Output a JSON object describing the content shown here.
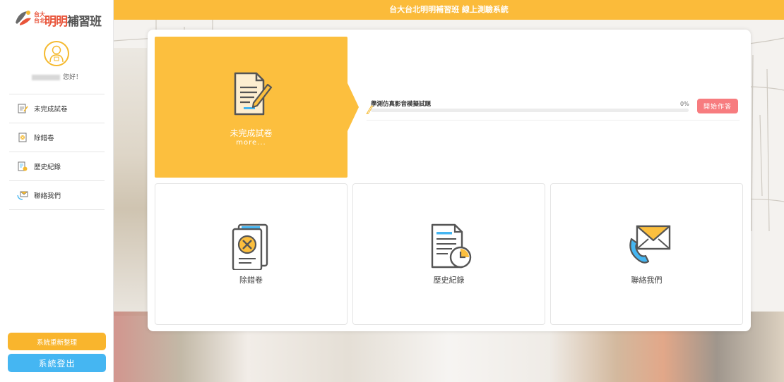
{
  "app": {
    "logo_small_top": "台大",
    "logo_small_bottom": "台北",
    "logo_big_colored": "明明",
    "logo_big_grey": "補習班",
    "top_title": "台大台北明明補習班 線上測驗系統"
  },
  "user": {
    "greeting_suffix": "您好！"
  },
  "sidebar": {
    "items": [
      {
        "label": "未完成試卷",
        "icon": "exam-edit-icon"
      },
      {
        "label": "除錯卷",
        "icon": "wrong-answer-icon"
      },
      {
        "label": "歷史紀錄",
        "icon": "history-icon"
      },
      {
        "label": "聯絡我們",
        "icon": "contact-icon"
      }
    ],
    "refresh_label": "系統重新整理",
    "logout_label": "系統登出"
  },
  "feature": {
    "title": "未完成試卷",
    "more": "more..."
  },
  "exam": {
    "name": "學測仿真影音模擬試題",
    "progress_text": "0%",
    "progress": 0,
    "start_label": "開始作答"
  },
  "tiles": [
    {
      "label": "除錯卷",
      "icon": "wrong-answer-icon"
    },
    {
      "label": "歷史紀錄",
      "icon": "history-icon"
    },
    {
      "label": "聯絡我們",
      "icon": "contact-icon"
    }
  ],
  "colors": {
    "accent_yellow": "#fcbf3e",
    "topbar": "#fbbb3a",
    "logout_blue": "#45b6f2",
    "start_red": "#f77c7f"
  }
}
